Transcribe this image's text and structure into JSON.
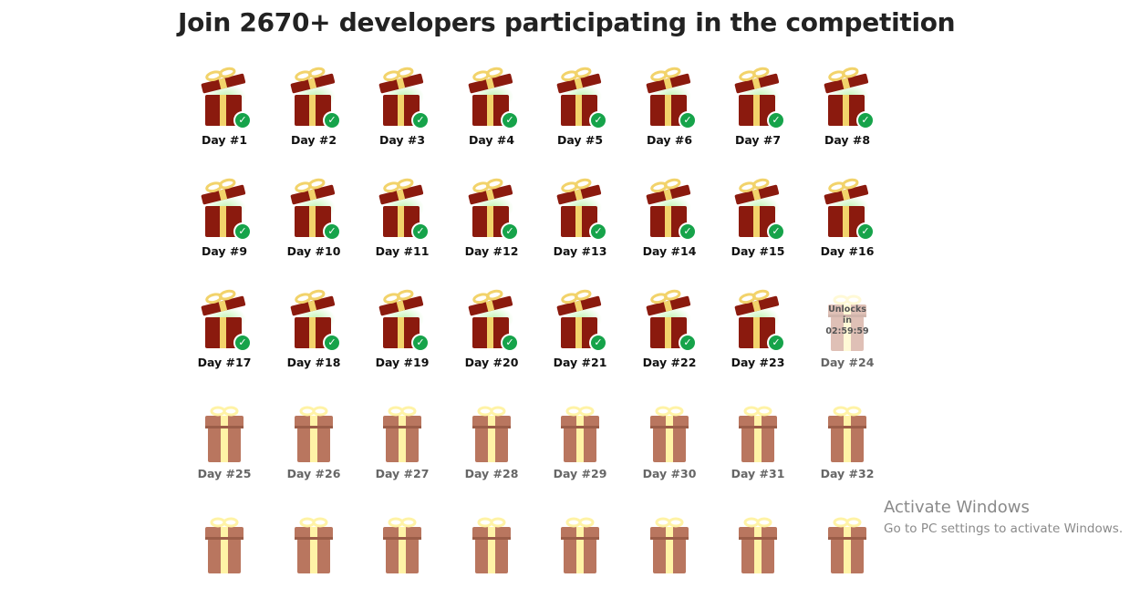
{
  "heading": "Join 2670+ developers participating in the competition",
  "countdown": {
    "label": "Unlocks in",
    "time": "02:59:59"
  },
  "days": [
    {
      "label": "Day #1",
      "state": "opened"
    },
    {
      "label": "Day #2",
      "state": "opened"
    },
    {
      "label": "Day #3",
      "state": "opened"
    },
    {
      "label": "Day #4",
      "state": "opened"
    },
    {
      "label": "Day #5",
      "state": "opened"
    },
    {
      "label": "Day #6",
      "state": "opened"
    },
    {
      "label": "Day #7",
      "state": "opened"
    },
    {
      "label": "Day #8",
      "state": "opened"
    },
    {
      "label": "Day #9",
      "state": "opened"
    },
    {
      "label": "Day #10",
      "state": "opened"
    },
    {
      "label": "Day #11",
      "state": "opened"
    },
    {
      "label": "Day #12",
      "state": "opened"
    },
    {
      "label": "Day #13",
      "state": "opened"
    },
    {
      "label": "Day #14",
      "state": "opened"
    },
    {
      "label": "Day #15",
      "state": "opened"
    },
    {
      "label": "Day #16",
      "state": "opened"
    },
    {
      "label": "Day #17",
      "state": "opened"
    },
    {
      "label": "Day #18",
      "state": "opened"
    },
    {
      "label": "Day #19",
      "state": "opened"
    },
    {
      "label": "Day #20",
      "state": "opened"
    },
    {
      "label": "Day #21",
      "state": "opened"
    },
    {
      "label": "Day #22",
      "state": "opened"
    },
    {
      "label": "Day #23",
      "state": "opened"
    },
    {
      "label": "Day #24",
      "state": "countdown"
    },
    {
      "label": "Day #25",
      "state": "locked"
    },
    {
      "label": "Day #26",
      "state": "locked"
    },
    {
      "label": "Day #27",
      "state": "locked"
    },
    {
      "label": "Day #28",
      "state": "locked"
    },
    {
      "label": "Day #29",
      "state": "locked"
    },
    {
      "label": "Day #30",
      "state": "locked"
    },
    {
      "label": "Day #31",
      "state": "locked"
    },
    {
      "label": "Day #32",
      "state": "locked"
    },
    {
      "label": "",
      "state": "locked"
    },
    {
      "label": "",
      "state": "locked"
    },
    {
      "label": "",
      "state": "locked"
    },
    {
      "label": "",
      "state": "locked"
    },
    {
      "label": "",
      "state": "locked"
    },
    {
      "label": "",
      "state": "locked"
    },
    {
      "label": "",
      "state": "locked"
    },
    {
      "label": "",
      "state": "locked"
    }
  ],
  "icons": {
    "opened": "gift-opened-icon",
    "locked": "gift-locked-icon",
    "check": "checkmark-icon"
  },
  "colors": {
    "gift_red": "#8b1a0e",
    "ribbon_gold": "#f2d36b",
    "glow_green": "#bff5b0",
    "locked_box": "#b9765f",
    "locked_ribbon": "#fff3a6",
    "check_green": "#16a34a"
  },
  "watermark": {
    "title": "Activate Windows",
    "subtitle": "Go to PC settings to activate Windows."
  }
}
